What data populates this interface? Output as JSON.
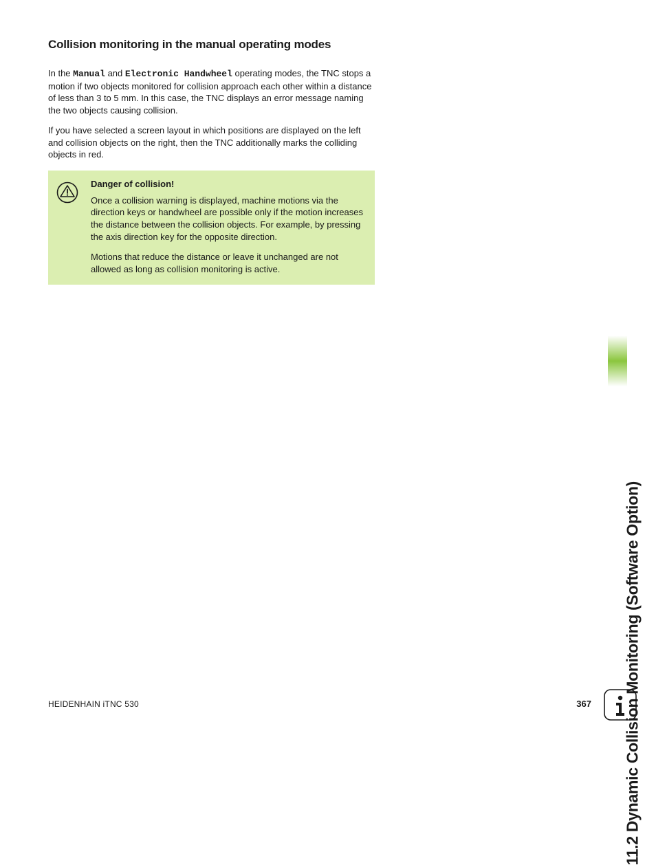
{
  "heading": "Collision monitoring in the manual operating modes",
  "para1_pre": "In the ",
  "para1_mode1": "Manual",
  "para1_mid": " and ",
  "para1_mode2": "Electronic Handwheel",
  "para1_post": " operating modes, the TNC stops a motion if two objects monitored for collision approach each other within a distance of less than 3 to 5 mm. In this case, the TNC displays an error message naming the two objects causing collision.",
  "para2": "If you have selected a screen layout in which positions are displayed on the left and collision objects on the right, then the TNC additionally marks the colliding objects in red.",
  "warning": {
    "title": "Danger of collision!",
    "p1": "Once a collision warning is displayed, machine motions via the direction keys or handwheel are possible only if the motion increases the distance between the collision objects. For example, by pressing the axis direction key for the opposite direction.",
    "p2": "Motions that reduce the distance or leave it unchanged are not allowed as long as collision monitoring is active."
  },
  "side_title": "11.2 Dynamic Collision Monitoring (Software Option)",
  "footer": {
    "left": "HEIDENHAIN iTNC 530",
    "page": "367"
  }
}
